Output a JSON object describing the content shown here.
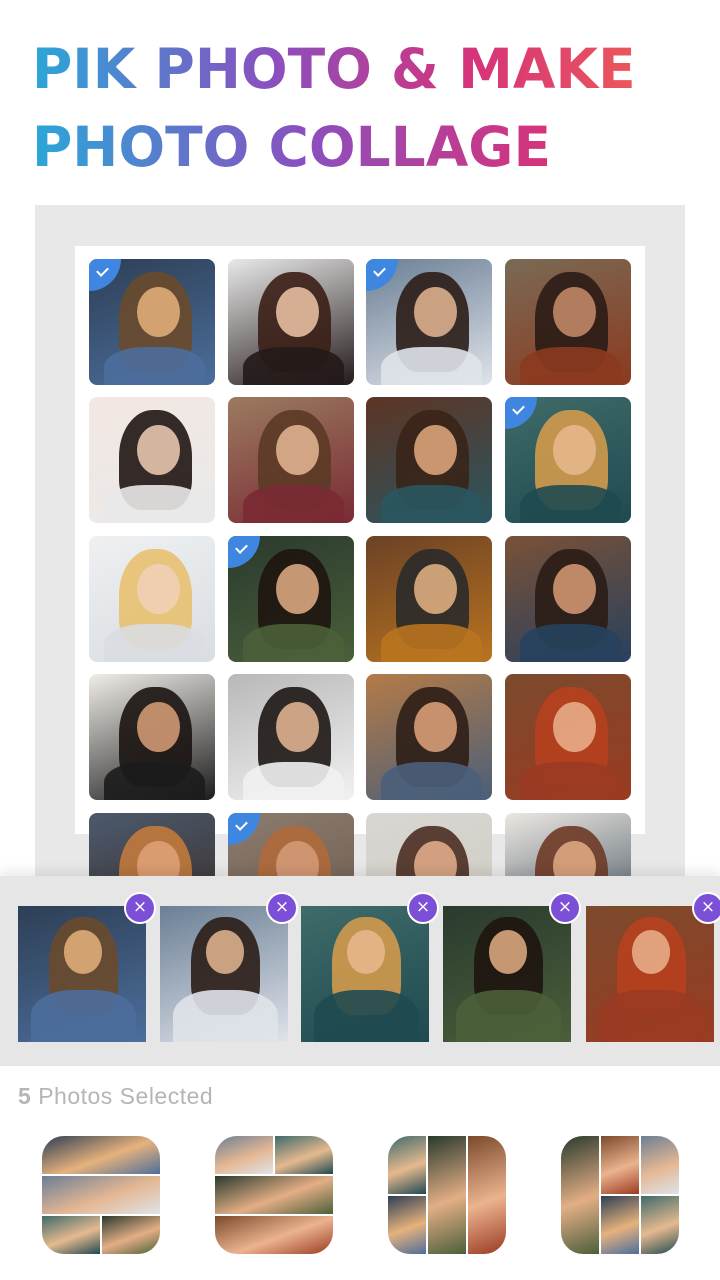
{
  "headline": {
    "line1": "PIK PHOTO & MAKE",
    "line2": "PHOTO COLLAGE"
  },
  "gallery": {
    "photos": [
      {
        "selected": true
      },
      {
        "selected": false
      },
      {
        "selected": true
      },
      {
        "selected": false
      },
      {
        "selected": false
      },
      {
        "selected": false
      },
      {
        "selected": false
      },
      {
        "selected": true
      },
      {
        "selected": false
      },
      {
        "selected": true
      },
      {
        "selected": false
      },
      {
        "selected": false
      },
      {
        "selected": false
      },
      {
        "selected": false
      },
      {
        "selected": false
      },
      {
        "selected": false
      },
      {
        "selected": false
      },
      {
        "selected": true
      },
      {
        "selected": false
      },
      {
        "selected": false
      }
    ]
  },
  "selected_tray": {
    "remove_icon": "×",
    "items": [
      {
        "name": "selected-photo-1"
      },
      {
        "name": "selected-photo-2"
      },
      {
        "name": "selected-photo-3"
      },
      {
        "name": "selected-photo-4"
      },
      {
        "name": "selected-photo-5"
      }
    ]
  },
  "status": {
    "count": "5",
    "label": "Photos Selected"
  },
  "layouts": {
    "options": [
      "layout-1",
      "layout-2",
      "layout-3",
      "layout-4"
    ]
  },
  "colors": {
    "accent_check": "#3f86e0",
    "remove_badge": "#7b4fd6",
    "headline_gradient": [
      "#2aa7d8",
      "#8a4fc0",
      "#d6337a",
      "#f5684a"
    ]
  }
}
